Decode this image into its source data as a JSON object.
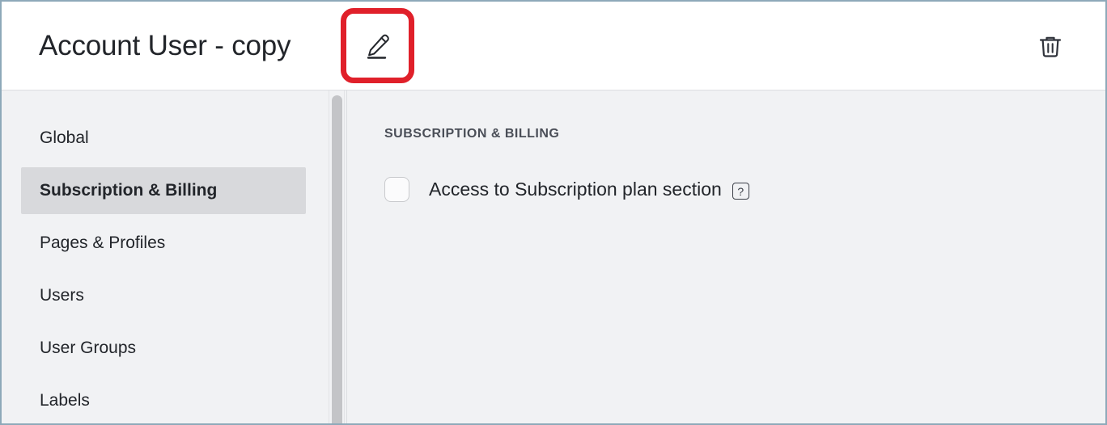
{
  "header": {
    "title": "Account User - copy",
    "edit_icon": "pencil-edit-icon",
    "delete_icon": "trash-delete-icon"
  },
  "highlight": {
    "color": "#e0202a",
    "target": "edit-button"
  },
  "sidebar": {
    "items": [
      {
        "label": "Global",
        "selected": false
      },
      {
        "label": "Subscription & Billing",
        "selected": true
      },
      {
        "label": "Pages & Profiles",
        "selected": false
      },
      {
        "label": "Users",
        "selected": false
      },
      {
        "label": "User Groups",
        "selected": false
      },
      {
        "label": "Labels",
        "selected": false
      }
    ]
  },
  "main": {
    "section_heading": "SUBSCRIPTION & BILLING",
    "options": [
      {
        "label": "Access to Subscription plan section",
        "checked": false,
        "help_icon": "question-mark-icon",
        "help_glyph": "?"
      }
    ]
  },
  "colors": {
    "window_border": "#8ea9b9",
    "panel_bg": "#f1f2f4",
    "header_bg": "#ffffff",
    "selected_item_bg": "#d8d9dc",
    "text": "#22252a",
    "heading_text": "#4a4e57",
    "highlight_red": "#e0202a",
    "scrollbar_thumb": "#c3c4c7"
  }
}
